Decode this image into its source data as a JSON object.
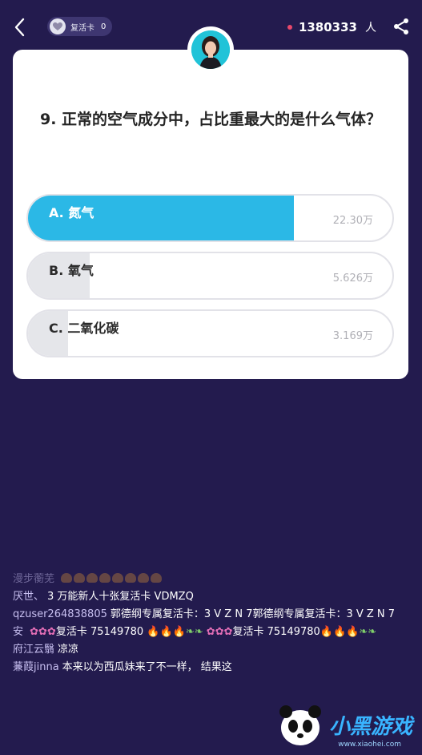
{
  "header": {
    "revive_label": "复活卡",
    "revive_count": "0",
    "viewer_count": "1380333",
    "viewer_unit": "人"
  },
  "question": {
    "text": "9. 正常的空气成分中，占比重最大的是什么气体？"
  },
  "options": [
    {
      "label": "A. 氮气",
      "count": "22.30万",
      "fill_fraction": 0.73,
      "selected": true
    },
    {
      "label": "B. 氧气",
      "count": "5.626万",
      "fill_fraction": 0.17,
      "selected": false
    },
    {
      "label": "C. 二氧化碳",
      "count": "3.169万",
      "fill_fraction": 0.11,
      "selected": false
    }
  ],
  "chat": [
    {
      "user": "漫步蘅芜",
      "text": ""
    },
    {
      "user": "厌世、",
      "text": "3 万能新人十张复活卡  VDMZQ"
    },
    {
      "user": "qzuser264838805",
      "text": "郭德纲专属复活卡：3 V Z N 7郭德纲专属复活卡：3 V Z N 7"
    },
    {
      "user": "安",
      "text_1": "复活卡 75149780",
      "text_2": "复活卡 75149780"
    },
    {
      "user": "府江云翳",
      "text": "凉凉"
    },
    {
      "user": "蒹葭jinna",
      "text": "本来以为西瓜妹来了不一样，  结果这"
    }
  ],
  "watermark": {
    "text": "小黑游戏",
    "url": "www.xiaohei.com"
  },
  "colors": {
    "background": "#231b4e",
    "accent": "#2bb8e6",
    "viewer_dot": "#e8486b"
  }
}
